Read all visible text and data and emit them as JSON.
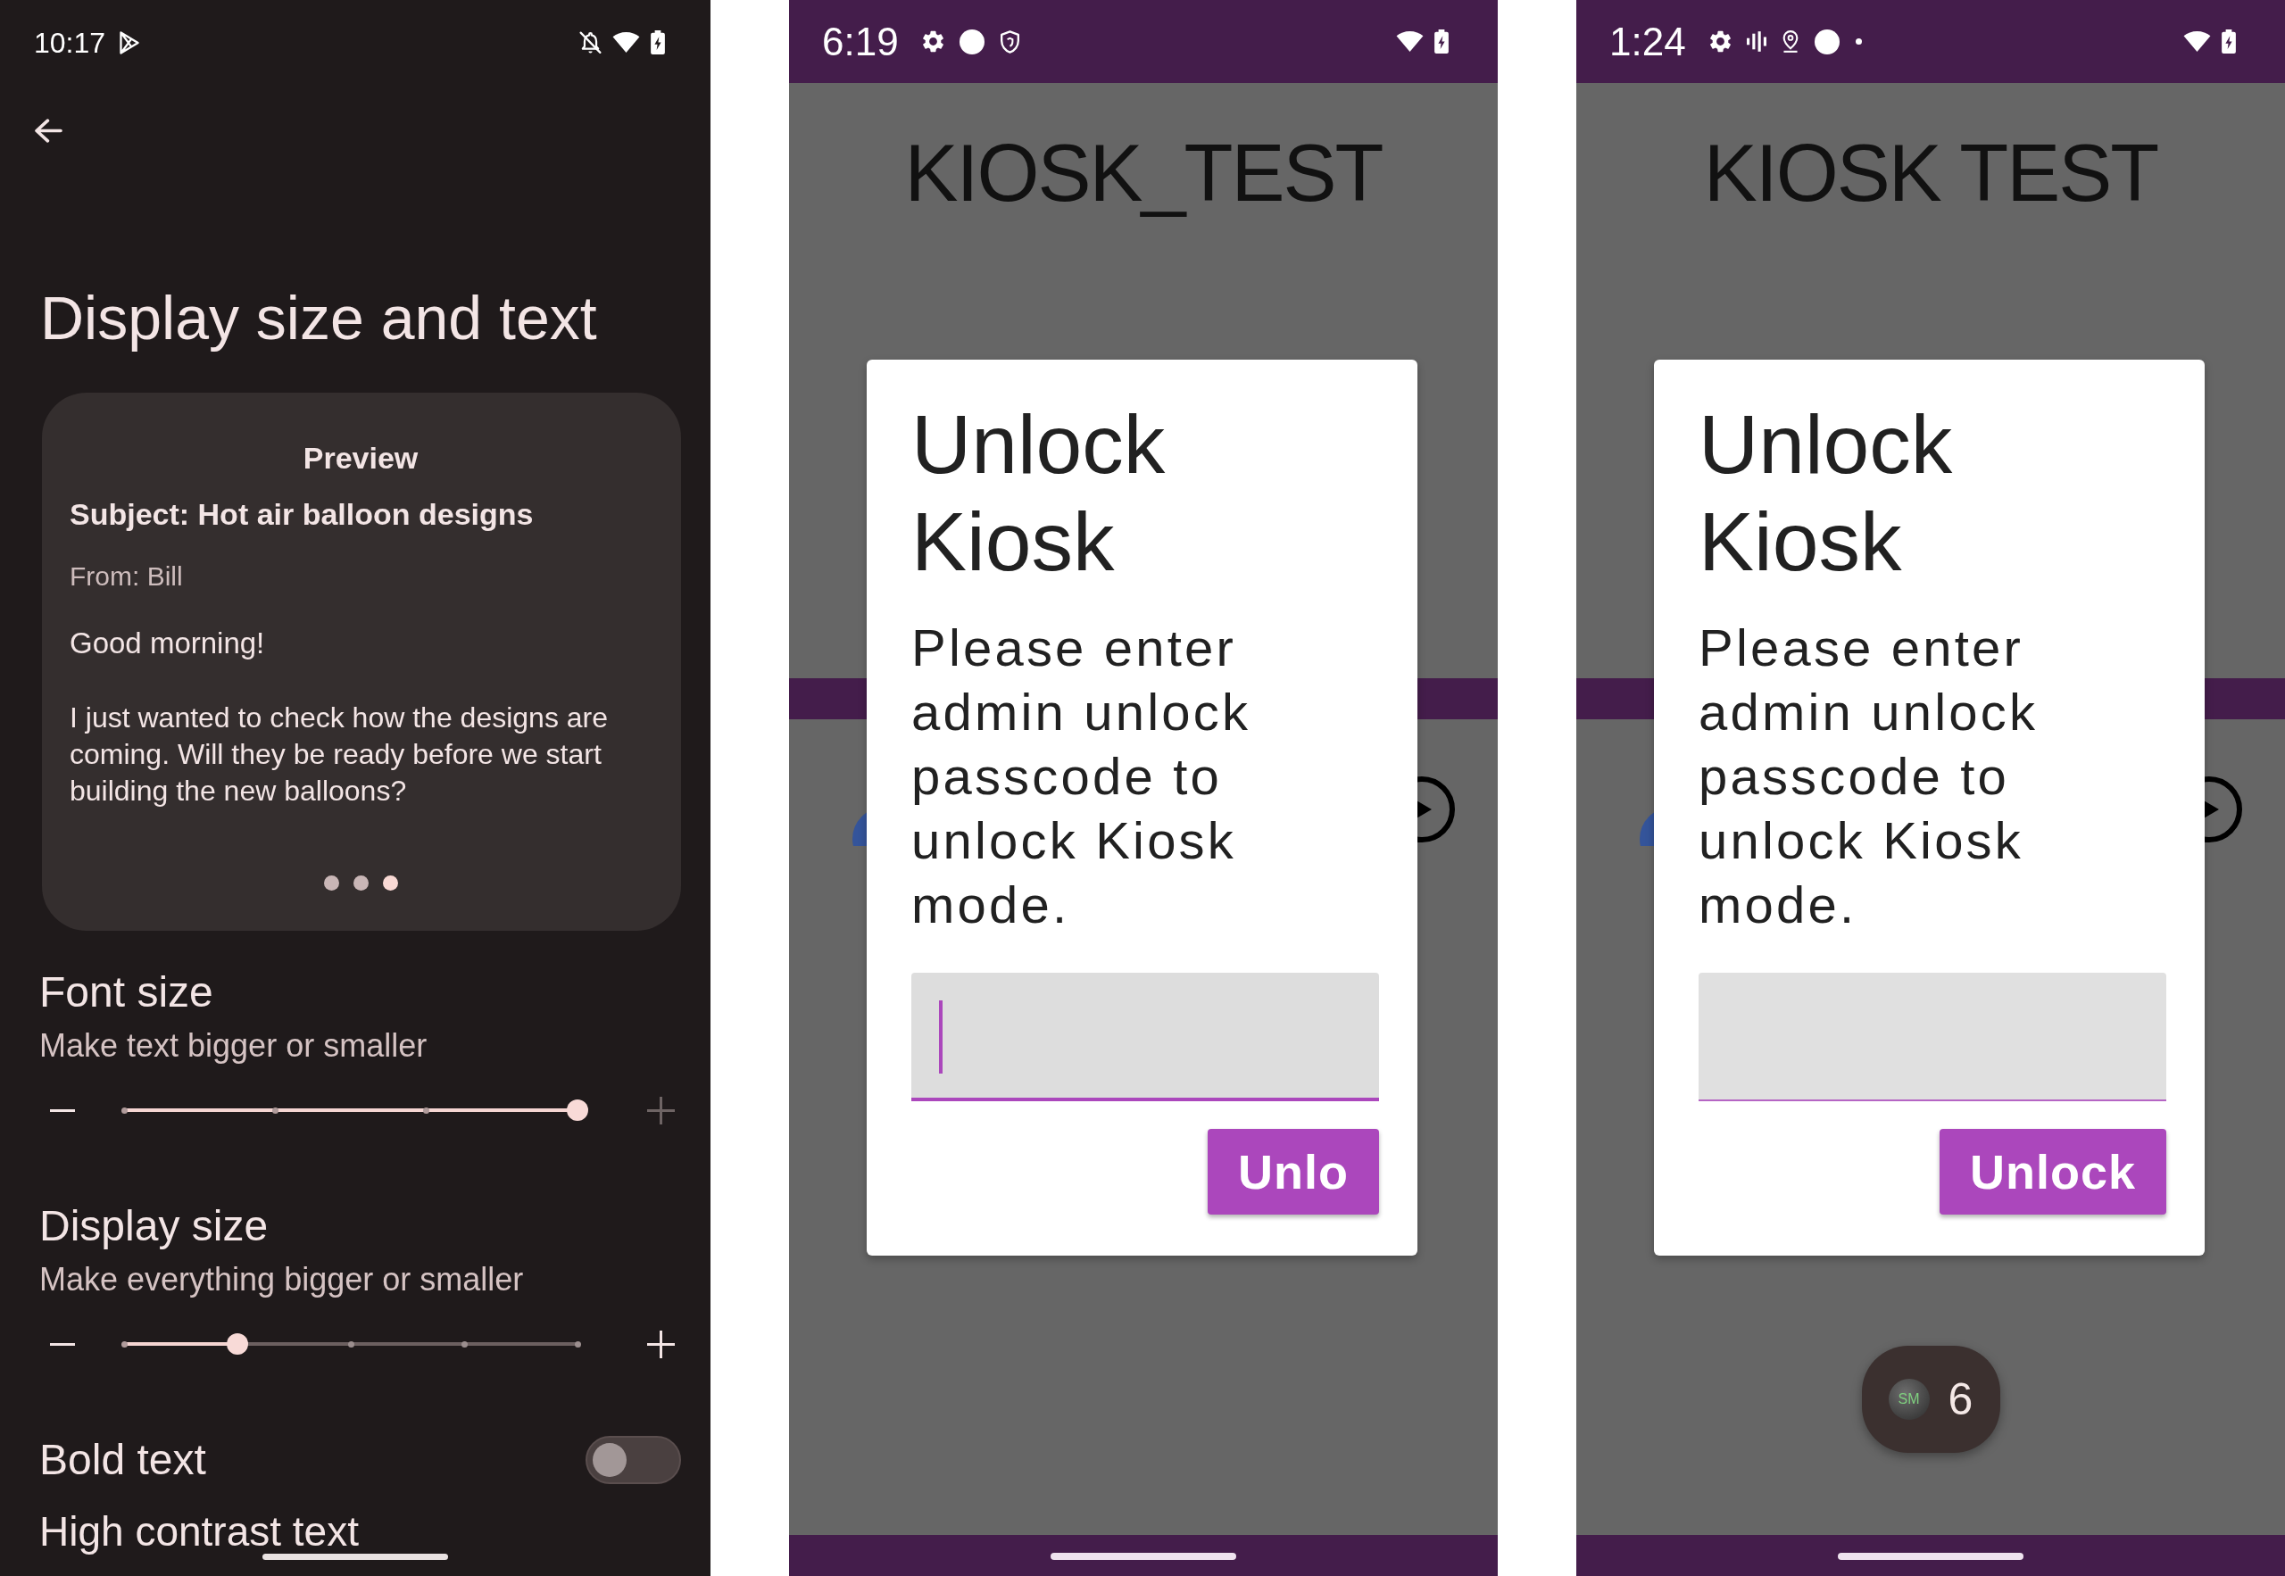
{
  "screens": [
    {
      "kind": "settings",
      "status_bar": {
        "time": "10:17",
        "notification_icons": [
          {
            "kind": "play"
          }
        ],
        "system_icons": [
          {
            "kind": "bell_off"
          },
          {
            "kind": "wifi"
          },
          {
            "kind": "battery"
          }
        ]
      },
      "title": "Display size and text",
      "preview": {
        "heading": "Preview",
        "subject": "Subject: Hot air balloon designs",
        "sender": "From: Bill",
        "greeting": "Good morning!",
        "body": "I just wanted to check how the designs are coming. Will they be ready before we start building the new balloons?",
        "pages": [
          {
            "selected": false
          },
          {
            "selected": false
          },
          {
            "selected": true
          }
        ]
      },
      "settings": [
        {
          "kind": "slider",
          "title": "Font size",
          "summary": "Make text bigger or smaller",
          "level": 1,
          "ticks": [
            {
              "level": 0
            },
            {
              "level": 0.3333
            },
            {
              "level": 0.6667
            }
          ],
          "decrease_disabled": false,
          "increase_disabled": true
        },
        {
          "kind": "slider",
          "title": "Display size",
          "summary": "Make everything bigger or smaller",
          "level": 0.25,
          "ticks": [
            {
              "level": 0
            },
            {
              "level": 0.5
            },
            {
              "level": 0.75
            },
            {
              "level": 1
            }
          ],
          "decrease_disabled": false,
          "increase_disabled": false
        },
        {
          "kind": "switch",
          "title": "Bold text",
          "on": false
        },
        {
          "kind": "label",
          "title": "High contrast text"
        }
      ]
    },
    {
      "kind": "kiosk",
      "status_bar": {
        "time": "6:19",
        "notification_icons": [
          {
            "kind": "gear"
          },
          {
            "kind": "dot"
          },
          {
            "kind": "shield"
          }
        ],
        "system_icons": [
          {
            "kind": "wifi"
          },
          {
            "kind": "battery"
          }
        ]
      },
      "app_title": "KIOSK_TEST",
      "dialog": {
        "title": "Unlock Kiosk",
        "message": "Please enter admin unlock passcode to unlock Kiosk mode.",
        "field": {
          "focused": true
        },
        "button": "Unlo"
      }
    },
    {
      "kind": "kiosk",
      "status_bar": {
        "time": "1:24",
        "notification_icons": [
          {
            "kind": "gear"
          },
          {
            "kind": "bars"
          },
          {
            "kind": "pin"
          },
          {
            "kind": "dot"
          },
          {
            "kind": "small_dot"
          }
        ],
        "system_icons": [
          {
            "kind": "wifi"
          },
          {
            "kind": "battery"
          }
        ]
      },
      "app_title": "KIOSK TEST",
      "dialog": {
        "title": "Unlock Kiosk",
        "message": "Please enter admin unlock passcode to unlock Kiosk mode.",
        "field": {
          "focused": false
        },
        "button": "Unlock"
      },
      "bubble": {
        "logo": "SM",
        "count": "6"
      }
    }
  ]
}
